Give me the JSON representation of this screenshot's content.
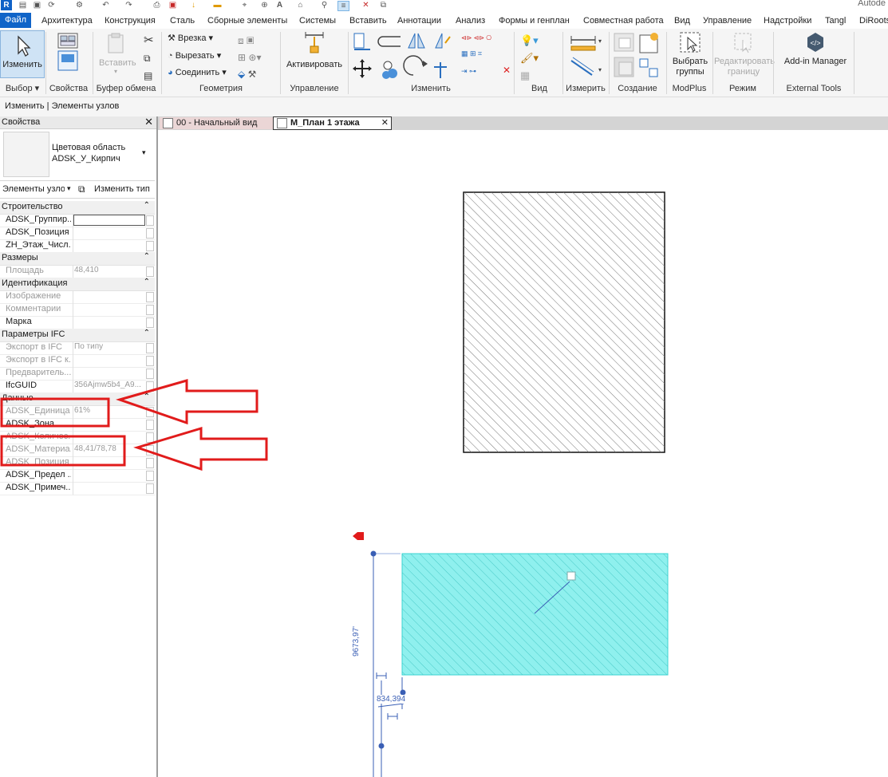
{
  "quick_access": {
    "logo": "R",
    "title_fragment": "Autode"
  },
  "menu_tabs": [
    "Файл",
    "Архитектура",
    "Конструкция",
    "Сталь",
    "Сборные элементы",
    "Системы",
    "Вставить",
    "Аннотации",
    "Анализ",
    "Формы и генплан",
    "Совместная работа",
    "Вид",
    "Управление",
    "Надстройки",
    "Tangl",
    "DiRoots"
  ],
  "ribbon": {
    "modify_label": "Изменить",
    "paste_label": "Вставить",
    "cut_label": "Врезка",
    "cutout_label": "Вырезать",
    "join_label": "Соединить",
    "activate_label": "Активировать",
    "select_group_label": "Выбрать группы",
    "edit_boundary_label": "Редактировать границу",
    "addin_label": "Add-in Manager",
    "groups": [
      "Выбор",
      "Свойства",
      "Буфер обмена",
      "Геометрия",
      "Управление",
      "Изменить",
      "Вид",
      "Измерить",
      "Создание",
      "ModPlus",
      "Режим",
      "External Tools"
    ]
  },
  "mode_bar": {
    "text": "Изменить | Элементы узлов"
  },
  "properties": {
    "title": "Свойства",
    "type_name_line1": "Цветовая область",
    "type_name_line2": "ADSK_У_Кирпич",
    "filter": "Элементы узло",
    "edit_type": "Изменить тип",
    "sections": [
      {
        "title": "Строительство",
        "rows": [
          {
            "key": "ADSK_Группир...",
            "value": "",
            "greyed": false,
            "input": true
          },
          {
            "key": "ADSK_Позиция",
            "value": "",
            "greyed": false
          },
          {
            "key": "ZH_Этаж_Числ...",
            "value": "",
            "greyed": false
          }
        ]
      },
      {
        "title": "Размеры",
        "rows": [
          {
            "key": "Площадь",
            "value": "48,410",
            "greyed": true
          }
        ]
      },
      {
        "title": "Идентификация",
        "rows": [
          {
            "key": "Изображение",
            "value": "",
            "greyed": true
          },
          {
            "key": "Комментарии",
            "value": "",
            "greyed": true
          },
          {
            "key": "Марка",
            "value": "",
            "greyed": false
          }
        ]
      },
      {
        "title": "Параметры IFC",
        "rows": [
          {
            "key": "Экспорт в IFC",
            "value": "По типу",
            "greyed": true
          },
          {
            "key": "Экспорт в IFC к...",
            "value": "",
            "greyed": true
          },
          {
            "key": "Предваритель...",
            "value": "",
            "greyed": true
          },
          {
            "key": "IfcGUID",
            "value": "356Ajmw5b4_A9...",
            "greyed": false
          }
        ]
      },
      {
        "title": "Данные",
        "rows": [
          {
            "key": "ADSK_Единица ...",
            "value": "61%",
            "greyed": true
          },
          {
            "key": "ADSK_Зона",
            "value": "",
            "greyed": false
          },
          {
            "key": "ADSK_Количес...",
            "value": "",
            "greyed": true
          },
          {
            "key": "ADSK_Материа...",
            "value": "48,41/78,78",
            "greyed": true
          },
          {
            "key": "ADSK_Позиция",
            "value": "",
            "greyed": true
          },
          {
            "key": "ADSK_Предел ...",
            "value": "",
            "greyed": false
          },
          {
            "key": "ADSK_Примеч...",
            "value": "",
            "greyed": false
          }
        ]
      }
    ]
  },
  "view_tabs": [
    {
      "label": "00 - Начальный вид",
      "active": false
    },
    {
      "label": "М_План 1 этажа",
      "active": true
    }
  ],
  "canvas": {
    "dim_vertical": "9673,97'",
    "dim_small": "834,394",
    "colors": {
      "hatch_fill": "#8ff0ee",
      "annotation_red": "#e11b1b",
      "dimension_blue": "#3a5fb5"
    }
  }
}
